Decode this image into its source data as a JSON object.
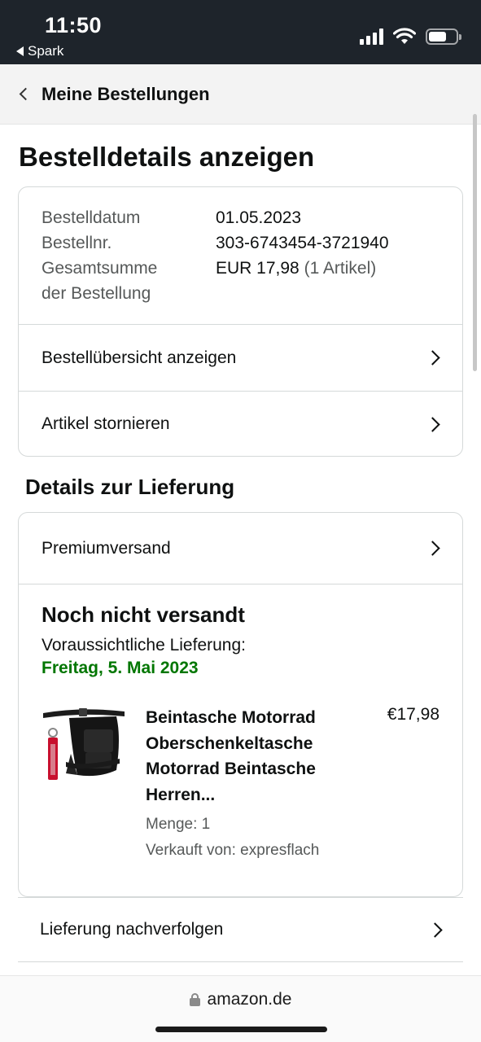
{
  "status_bar": {
    "time": "11:50",
    "back_app": "Spark",
    "battery_level": 0.65
  },
  "nav": {
    "back_title": "Meine Bestellungen"
  },
  "page": {
    "title": "Bestelldetails anzeigen"
  },
  "order_summary": {
    "date_label": "Bestelldatum",
    "date_value": "01.05.2023",
    "number_label": "Bestellnr.",
    "number_value": "303-6743454-3721940",
    "total_label_line1": "Gesamtsumme",
    "total_label_line2": "der Bestellung",
    "total_value": "EUR 17,98",
    "item_count": "(1 Artikel)",
    "links": [
      {
        "label": "Bestellübersicht anzeigen"
      },
      {
        "label": "Artikel stornieren"
      }
    ]
  },
  "delivery": {
    "section_title": "Details zur Lieferung",
    "shipping_method": "Premiumversand",
    "status": "Noch nicht versandt",
    "eta_label": "Voraussichtliche Lieferung:",
    "eta_date": "Freitag, 5. Mai 2023",
    "item": {
      "title": "Beintasche Motorrad Oberschenkeltasche Motorrad Beintasche Herren...",
      "price": "€17,98",
      "quantity": "Menge: 1",
      "seller": "Verkauft von: expresflach"
    },
    "track_label": "Lieferung nachverfolgen"
  },
  "browser": {
    "url": "amazon.de"
  },
  "colors": {
    "accent_green": "#007600",
    "status_bar_bg": "#1e242b"
  },
  "icons": [
    "back-chevron-icon",
    "signal-icon",
    "wifi-icon",
    "battery-icon",
    "chevron-right-icon",
    "lock-icon"
  ]
}
